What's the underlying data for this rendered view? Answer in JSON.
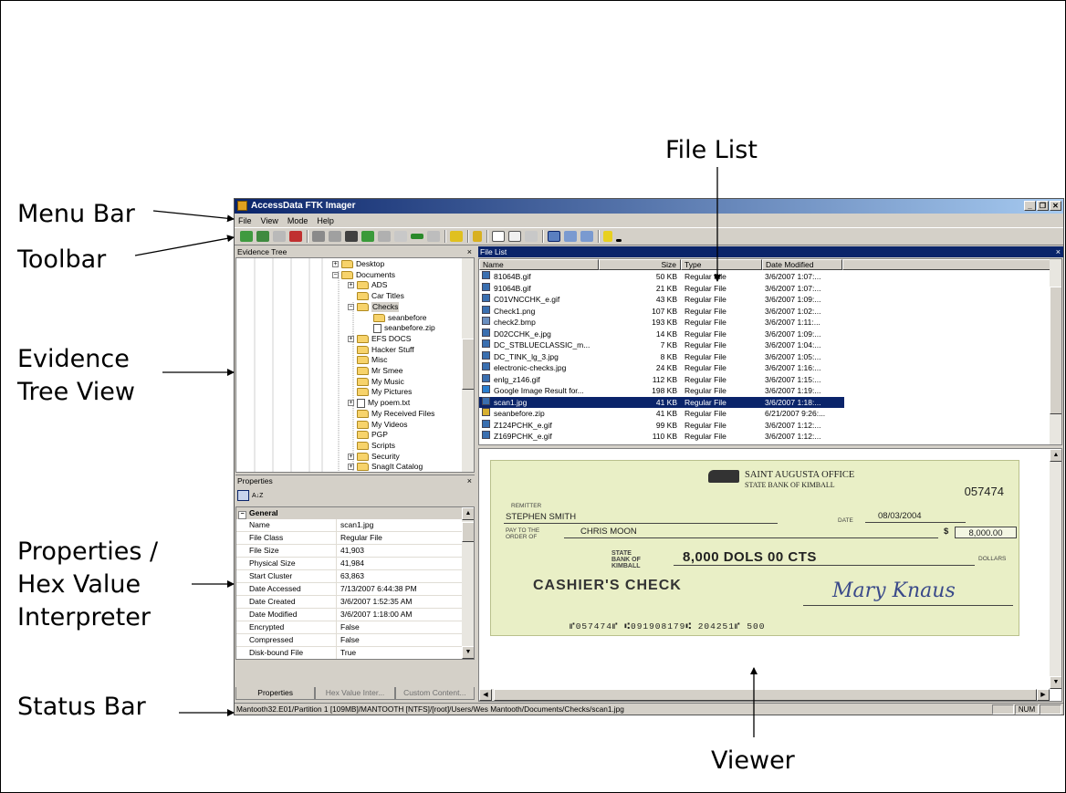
{
  "callouts": {
    "menu_bar": "Menu Bar",
    "toolbar": "Toolbar",
    "evidence_tree": "Evidence Tree View",
    "properties": "Properties / Hex Value Interpreter",
    "status_bar": "Status Bar",
    "file_list": "File List",
    "viewer": "Viewer"
  },
  "window": {
    "title": "AccessData FTK Imager",
    "menus": [
      "File",
      "View",
      "Mode",
      "Help"
    ]
  },
  "evidence_tree": {
    "header": "Evidence Tree",
    "close": "×",
    "items": [
      {
        "label": "Desktop",
        "type": "folder",
        "expander": "+"
      },
      {
        "label": "Documents",
        "type": "folder",
        "expander": "−"
      },
      {
        "label": "ADS",
        "type": "folder",
        "expander": "+"
      },
      {
        "label": "Car Titles",
        "type": "folder",
        "expander": ""
      },
      {
        "label": "Checks",
        "type": "folder",
        "expander": "−",
        "selected": true
      },
      {
        "label": "seanbefore",
        "type": "folder",
        "expander": ""
      },
      {
        "label": "seanbefore.zip",
        "type": "file",
        "expander": ""
      },
      {
        "label": "EFS DOCS",
        "type": "folder",
        "expander": "+"
      },
      {
        "label": "Hacker Stuff",
        "type": "folder",
        "expander": ""
      },
      {
        "label": "Misc",
        "type": "folder",
        "expander": ""
      },
      {
        "label": "Mr Smee",
        "type": "folder",
        "expander": ""
      },
      {
        "label": "My Music",
        "type": "folder",
        "expander": ""
      },
      {
        "label": "My Pictures",
        "type": "folder",
        "expander": ""
      },
      {
        "label": "My poem.txt",
        "type": "file",
        "expander": "+"
      },
      {
        "label": "My Received Files",
        "type": "folder",
        "expander": ""
      },
      {
        "label": "My Videos",
        "type": "folder",
        "expander": ""
      },
      {
        "label": "PGP",
        "type": "folder",
        "expander": ""
      },
      {
        "label": "Scripts",
        "type": "folder",
        "expander": ""
      },
      {
        "label": "Security",
        "type": "folder",
        "expander": "+"
      },
      {
        "label": "SnagIt Catalog",
        "type": "folder",
        "expander": "+"
      }
    ]
  },
  "properties": {
    "header": "Properties",
    "close": "×",
    "sort_label": "A↓Z",
    "section": "General",
    "rows": [
      {
        "k": "Name",
        "v": "scan1.jpg"
      },
      {
        "k": "File Class",
        "v": "Regular File"
      },
      {
        "k": "File Size",
        "v": "41,903"
      },
      {
        "k": "Physical Size",
        "v": "41,984"
      },
      {
        "k": "Start Cluster",
        "v": "63,863"
      },
      {
        "k": "Date Accessed",
        "v": "7/13/2007 6:44:38 PM"
      },
      {
        "k": "Date Created",
        "v": "3/6/2007 1:52:35 AM"
      },
      {
        "k": "Date Modified",
        "v": "3/6/2007 1:18:00 AM"
      },
      {
        "k": "Encrypted",
        "v": "False"
      },
      {
        "k": "Compressed",
        "v": "False"
      },
      {
        "k": "Disk-bound File",
        "v": "True"
      }
    ],
    "tabs": [
      "Properties",
      "Hex Value Inter...",
      "Custom Content..."
    ]
  },
  "file_list": {
    "header": "File List",
    "close": "×",
    "columns": [
      "Name",
      "Size",
      "Type",
      "Date Modified"
    ],
    "rows": [
      {
        "name": "81064B.gif",
        "size": "50 KB",
        "type": "Regular File",
        "date": "3/6/2007 1:07:...",
        "icon": "#3a6fb0"
      },
      {
        "name": "91064B.gif",
        "size": "21 KB",
        "type": "Regular File",
        "date": "3/6/2007 1:07:...",
        "icon": "#3a6fb0"
      },
      {
        "name": "C01VNCCHK_e.gif",
        "size": "43 KB",
        "type": "Regular File",
        "date": "3/6/2007 1:09:...",
        "icon": "#3a6fb0"
      },
      {
        "name": "Check1.png",
        "size": "107 KB",
        "type": "Regular File",
        "date": "3/6/2007 1:02:...",
        "icon": "#3a6fb0"
      },
      {
        "name": "check2.bmp",
        "size": "193 KB",
        "type": "Regular File",
        "date": "3/6/2007 1:11:...",
        "icon": "#6a8fc0"
      },
      {
        "name": "D02CCHK_e.jpg",
        "size": "14 KB",
        "type": "Regular File",
        "date": "3/6/2007 1:09:...",
        "icon": "#3a6fb0"
      },
      {
        "name": "DC_STBLUECLASSIC_m...",
        "size": "7 KB",
        "type": "Regular File",
        "date": "3/6/2007 1:04:...",
        "icon": "#3a6fb0"
      },
      {
        "name": "DC_TINK_lg_3.jpg",
        "size": "8 KB",
        "type": "Regular File",
        "date": "3/6/2007 1:05:...",
        "icon": "#3a6fb0"
      },
      {
        "name": "electronic-checks.jpg",
        "size": "24 KB",
        "type": "Regular File",
        "date": "3/6/2007 1:16:...",
        "icon": "#3a6fb0"
      },
      {
        "name": "enlg_z146.gif",
        "size": "112 KB",
        "type": "Regular File",
        "date": "3/6/2007 1:15:...",
        "icon": "#3a6fb0"
      },
      {
        "name": "Google Image Result for...",
        "size": "198 KB",
        "type": "Regular File",
        "date": "3/6/2007 1:19:...",
        "icon": "#2a7fd0"
      },
      {
        "name": "scan1.jpg",
        "size": "41 KB",
        "type": "Regular File",
        "date": "3/6/2007 1:18:...",
        "icon": "#3a6fb0",
        "selected": true
      },
      {
        "name": "seanbefore.zip",
        "size": "41 KB",
        "type": "Regular File",
        "date": "6/21/2007 9:26:...",
        "icon": "#d8b030"
      },
      {
        "name": "Z124PCHK_e.gif",
        "size": "99 KB",
        "type": "Regular File",
        "date": "3/6/2007 1:12:...",
        "icon": "#3a6fb0"
      },
      {
        "name": "Z169PCHK_e.gif",
        "size": "110 KB",
        "type": "Regular File",
        "date": "3/6/2007 1:12:...",
        "icon": "#3a6fb0"
      }
    ]
  },
  "check": {
    "bank_name": "SAINT AUGUSTA OFFICE",
    "bank_sub": "STATE BANK OF KIMBALL",
    "check_number": "057474",
    "remitter_label": "REMITTER",
    "remitter": "STEPHEN SMITH",
    "date_label": "DATE",
    "date": "08/03/2004",
    "pay_label": "PAY TO THE ORDER OF",
    "payee": "CHRIS MOON",
    "dollar_sign": "$",
    "amount_box": "8,000.00",
    "state_bank_label": "STATE BANK OF KIMBALL",
    "amount_words": "8,000 DOLS 00 CTS",
    "dollars_label": "DOLLARS",
    "cashiers": "CASHIER'S CHECK",
    "signature": "Mary Knaus",
    "micr": "⑈057474⑈ ⑆091908179⑆   204251⑈      500"
  },
  "status_bar": {
    "path": "Mantooth32.E01/Partition 1 [109MB]/MANTOOTH [NTFS]/[root]/Users/Wes Mantooth/Documents/Checks/scan1.jpg",
    "num": "NUM"
  }
}
